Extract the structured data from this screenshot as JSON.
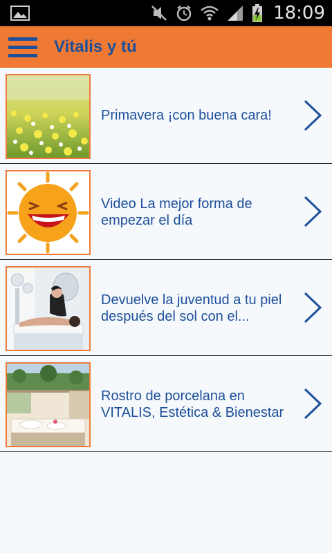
{
  "status_bar": {
    "time": "18:09",
    "icons": [
      "image-notification-icon",
      "mute-icon",
      "alarm-icon",
      "wifi-icon",
      "signal-icon",
      "battery-charging-icon"
    ]
  },
  "action_bar": {
    "title": "Vitalis y tú",
    "menu_icon": "hamburger-menu-icon"
  },
  "colors": {
    "action_bar": "#f07a33",
    "accent_text": "#1d4f9a",
    "thumb_border": "#ef7b3a",
    "background": "#f5f9fc"
  },
  "list": {
    "items": [
      {
        "title": "Primavera ¡con buena cara!",
        "thumbnail": "spring-flower-field-image"
      },
      {
        "title": "Video La mejor forma de empezar el día",
        "thumbnail": "laughing-sun-image"
      },
      {
        "title": "Devuelve la juventud a tu piel después del sol con el...",
        "thumbnail": "spa-treatment-image"
      },
      {
        "title": "Rostro de porcelana en VITALIS, Estética & Bienestar",
        "thumbnail": "spa-room-image"
      }
    ]
  }
}
